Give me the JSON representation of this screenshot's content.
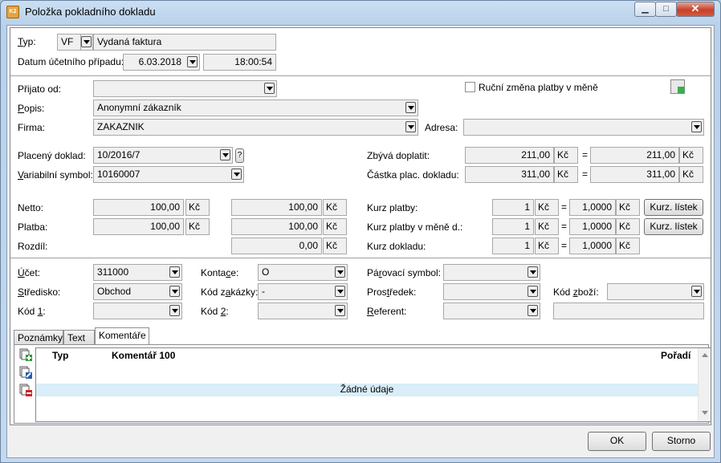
{
  "window": {
    "title": "Položka pokladního dokladu",
    "app_icon": "K2"
  },
  "header": {
    "typ_label": "Typ:",
    "typ_code": "VF",
    "typ_name": "Vydaná faktura",
    "datum_label": "Datum účetního případu:",
    "datum": "6.03.2018",
    "cas": "18:00:54"
  },
  "prijato": {
    "prijato_label": "Přijato od:",
    "prijato_value": "",
    "rucni_label": "Ruční změna platby v měně",
    "popis_label": "Popis:",
    "popis_value": "Anonymní zákazník",
    "firma_label": "Firma:",
    "firma_value": "ZAKAZNIK",
    "adresa_label": "Adresa:",
    "adresa_value": ""
  },
  "doklad": {
    "placeny_label": "Placený doklad:",
    "placeny_value": "10/2016/7",
    "placeny_help": "?",
    "vs_label": "Variabilní symbol:",
    "vs_value": "10160007",
    "zbyva_label": "Zbývá doplatit:",
    "zbyva_value": "211,00",
    "zbyva_value2": "211,00",
    "castka_label": "Částka plac. dokladu:",
    "castka_value": "311,00",
    "castka_value2": "311,00",
    "currency": "Kč",
    "equals": "="
  },
  "amounts": {
    "netto_label": "Netto:",
    "netto_value": "100,00",
    "netto_value2": "100,00",
    "platba_label": "Platba:",
    "platba_value": "100,00",
    "platba_value2": "100,00",
    "rozdil_label": "Rozdíl:",
    "rozdil_value": "0,00",
    "kurz_platby_label": "Kurz platby:",
    "kurz_platby_qty": "1",
    "kurz_platby_rate": "1,0000",
    "kurz_mene_label": "Kurz platby v měně d.:",
    "kurz_mene_qty": "1",
    "kurz_mene_rate": "1,0000",
    "kurz_dokladu_label": "Kurz dokladu:",
    "kurz_dokladu_qty": "1",
    "kurz_dokladu_rate": "1,0000",
    "kurz_listek": "Kurz. lístek"
  },
  "accounting": {
    "ucet_label": "Účet:",
    "ucet_value": "311000",
    "kontace_label": "Kontace:",
    "kontace_value": "O",
    "parovaci_label": "Párovací symbol:",
    "parovaci_value": "",
    "stredisko_label": "Středisko:",
    "stredisko_value": "Obchod",
    "kod_zakazky_label": "Kód zakázky:",
    "kod_zakazky_value": "-",
    "prostredek_label": "Prostředek:",
    "prostredek_value": "",
    "kod_zbozi_label": "Kód zboží:",
    "kod_zbozi_value": "",
    "kod1_label": "Kód 1:",
    "kod1_value": "",
    "kod2_label": "Kód 2:",
    "kod2_value": "",
    "referent_label": "Referent:",
    "referent_value": ""
  },
  "tabs": [
    {
      "label": "Poznámky"
    },
    {
      "label": "Text"
    },
    {
      "label": "Komentáře"
    }
  ],
  "grid": {
    "col_typ": "Typ",
    "col_komentar": "Komentář 100",
    "col_poradi": "Pořadí",
    "empty": "Žádné údaje"
  },
  "footer": {
    "ok": "OK",
    "storno": "Storno"
  }
}
